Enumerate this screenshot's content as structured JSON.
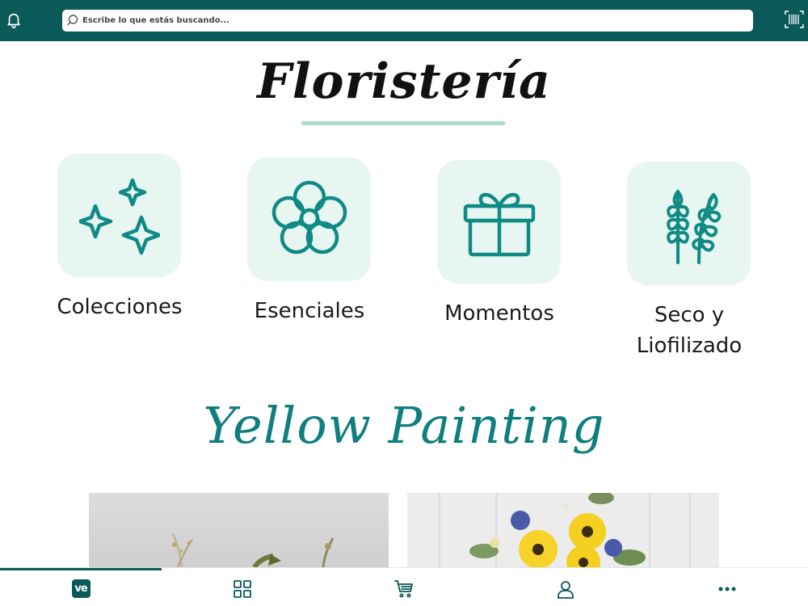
{
  "colors": {
    "brand": "#0b5a5a",
    "accent": "#0f7e7e",
    "tile_bg": "#e7f6f1",
    "underline": "#a9dcc7"
  },
  "header": {
    "search_placeholder": "Escribe lo que estás buscando...",
    "icons": [
      "bell-icon",
      "search-icon",
      "barcode-icon"
    ]
  },
  "page": {
    "title": "Floristería"
  },
  "categories": [
    {
      "label": "Colecciones",
      "icon": "sparkles-icon"
    },
    {
      "label": "Esenciales",
      "icon": "flower-icon"
    },
    {
      "label": "Momentos",
      "icon": "gift-icon"
    },
    {
      "label_line1": "Seco y",
      "label_line2": "Liofilizado",
      "icon": "wheat-icon"
    }
  ],
  "section": {
    "title": "Yellow Painting"
  },
  "bottom_nav": {
    "logo_text": "ve",
    "items": [
      "home-logo",
      "grid-icon",
      "cart-icon",
      "user-icon",
      "more-icon"
    ],
    "active_index": 0
  }
}
